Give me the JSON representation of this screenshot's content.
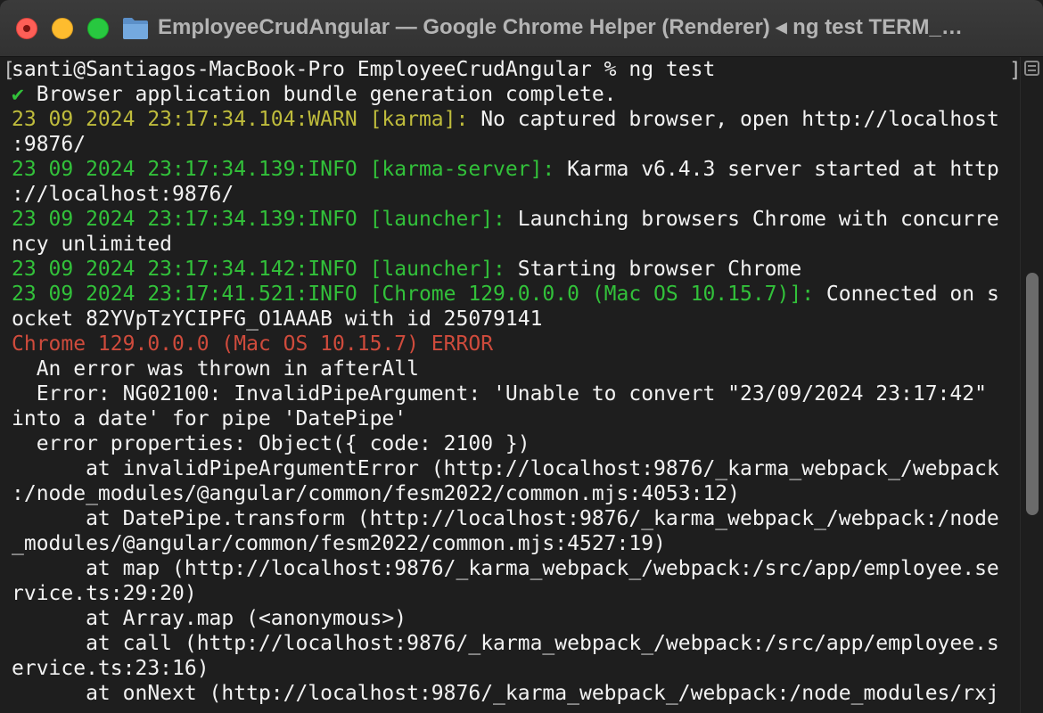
{
  "window": {
    "title": "EmployeeCrudAngular — Google Chrome Helper (Renderer) ◂ ng test TERM_…",
    "folder_icon": "folder-icon",
    "close_color": "#fe5f57",
    "minimize_color": "#febc2e",
    "maximize_color": "#28c840"
  },
  "terminal": {
    "colors": {
      "background": "#1e1e1e",
      "text": "#f2f2f2",
      "green": "#32c13a",
      "yellow": "#bfbc3c",
      "red": "#cf4b3c"
    },
    "lines": [
      [
        {
          "t": "santi@Santiagos-MacBook-Pro EmployeeCrudAngular % ng test",
          "c": "white"
        }
      ],
      [
        {
          "t": "✔",
          "c": "green"
        },
        {
          "t": " Browser application bundle generation complete.",
          "c": "white"
        }
      ],
      [
        {
          "t": "23 09 2024 23:17:34.104:WARN [karma]:",
          "c": "yellow"
        },
        {
          "t": " No captured browser, open http://localhost",
          "c": "white"
        }
      ],
      [
        {
          "t": ":9876/",
          "c": "white"
        }
      ],
      [
        {
          "t": "23 09 2024 23:17:34.139:INFO [karma-server]:",
          "c": "green"
        },
        {
          "t": " Karma v6.4.3 server started at http",
          "c": "white"
        }
      ],
      [
        {
          "t": "://localhost:9876/",
          "c": "white"
        }
      ],
      [
        {
          "t": "23 09 2024 23:17:34.139:INFO [launcher]:",
          "c": "green"
        },
        {
          "t": " Launching browsers Chrome with concurre",
          "c": "white"
        }
      ],
      [
        {
          "t": "ncy unlimited",
          "c": "white"
        }
      ],
      [
        {
          "t": "23 09 2024 23:17:34.142:INFO [launcher]:",
          "c": "green"
        },
        {
          "t": " Starting browser Chrome",
          "c": "white"
        }
      ],
      [
        {
          "t": "23 09 2024 23:17:41.521:INFO [Chrome 129.0.0.0 (Mac OS 10.15.7)]:",
          "c": "green"
        },
        {
          "t": " Connected on s",
          "c": "white"
        }
      ],
      [
        {
          "t": "ocket 82YVpTzYCIPFG_O1AAAB with id 25079141",
          "c": "white"
        }
      ],
      [
        {
          "t": "Chrome 129.0.0.0 (Mac OS 10.15.7) ERROR",
          "c": "red"
        }
      ],
      [
        {
          "t": "  An error was thrown in afterAll",
          "c": "white"
        }
      ],
      [
        {
          "t": "  Error: NG02100: InvalidPipeArgument: 'Unable to convert \"23/09/2024 23:17:42\"",
          "c": "white"
        }
      ],
      [
        {
          "t": "into a date' for pipe 'DatePipe'",
          "c": "white"
        }
      ],
      [
        {
          "t": "  error properties: Object({ code: 2100 })",
          "c": "white"
        }
      ],
      [
        {
          "t": "      at invalidPipeArgumentError (http://localhost:9876/_karma_webpack_/webpack",
          "c": "white"
        }
      ],
      [
        {
          "t": ":/node_modules/@angular/common/fesm2022/common.mjs:4053:12)",
          "c": "white"
        }
      ],
      [
        {
          "t": "      at DatePipe.transform (http://localhost:9876/_karma_webpack_/webpack:/node",
          "c": "white"
        }
      ],
      [
        {
          "t": "_modules/@angular/common/fesm2022/common.mjs:4527:19)",
          "c": "white"
        }
      ],
      [
        {
          "t": "      at map (http://localhost:9876/_karma_webpack_/webpack:/src/app/employee.se",
          "c": "white"
        }
      ],
      [
        {
          "t": "rvice.ts:29:20)",
          "c": "white"
        }
      ],
      [
        {
          "t": "      at Array.map (<anonymous>)",
          "c": "white"
        }
      ],
      [
        {
          "t": "      at call (http://localhost:9876/_karma_webpack_/webpack:/src/app/employee.s",
          "c": "white"
        }
      ],
      [
        {
          "t": "ervice.ts:23:16)",
          "c": "white"
        }
      ],
      [
        {
          "t": "      at onNext (http://localhost:9876/_karma_webpack_/webpack:/node_modules/rxj",
          "c": "white"
        }
      ]
    ]
  },
  "scrollbar": {
    "marks_icon": "marks-icon"
  }
}
